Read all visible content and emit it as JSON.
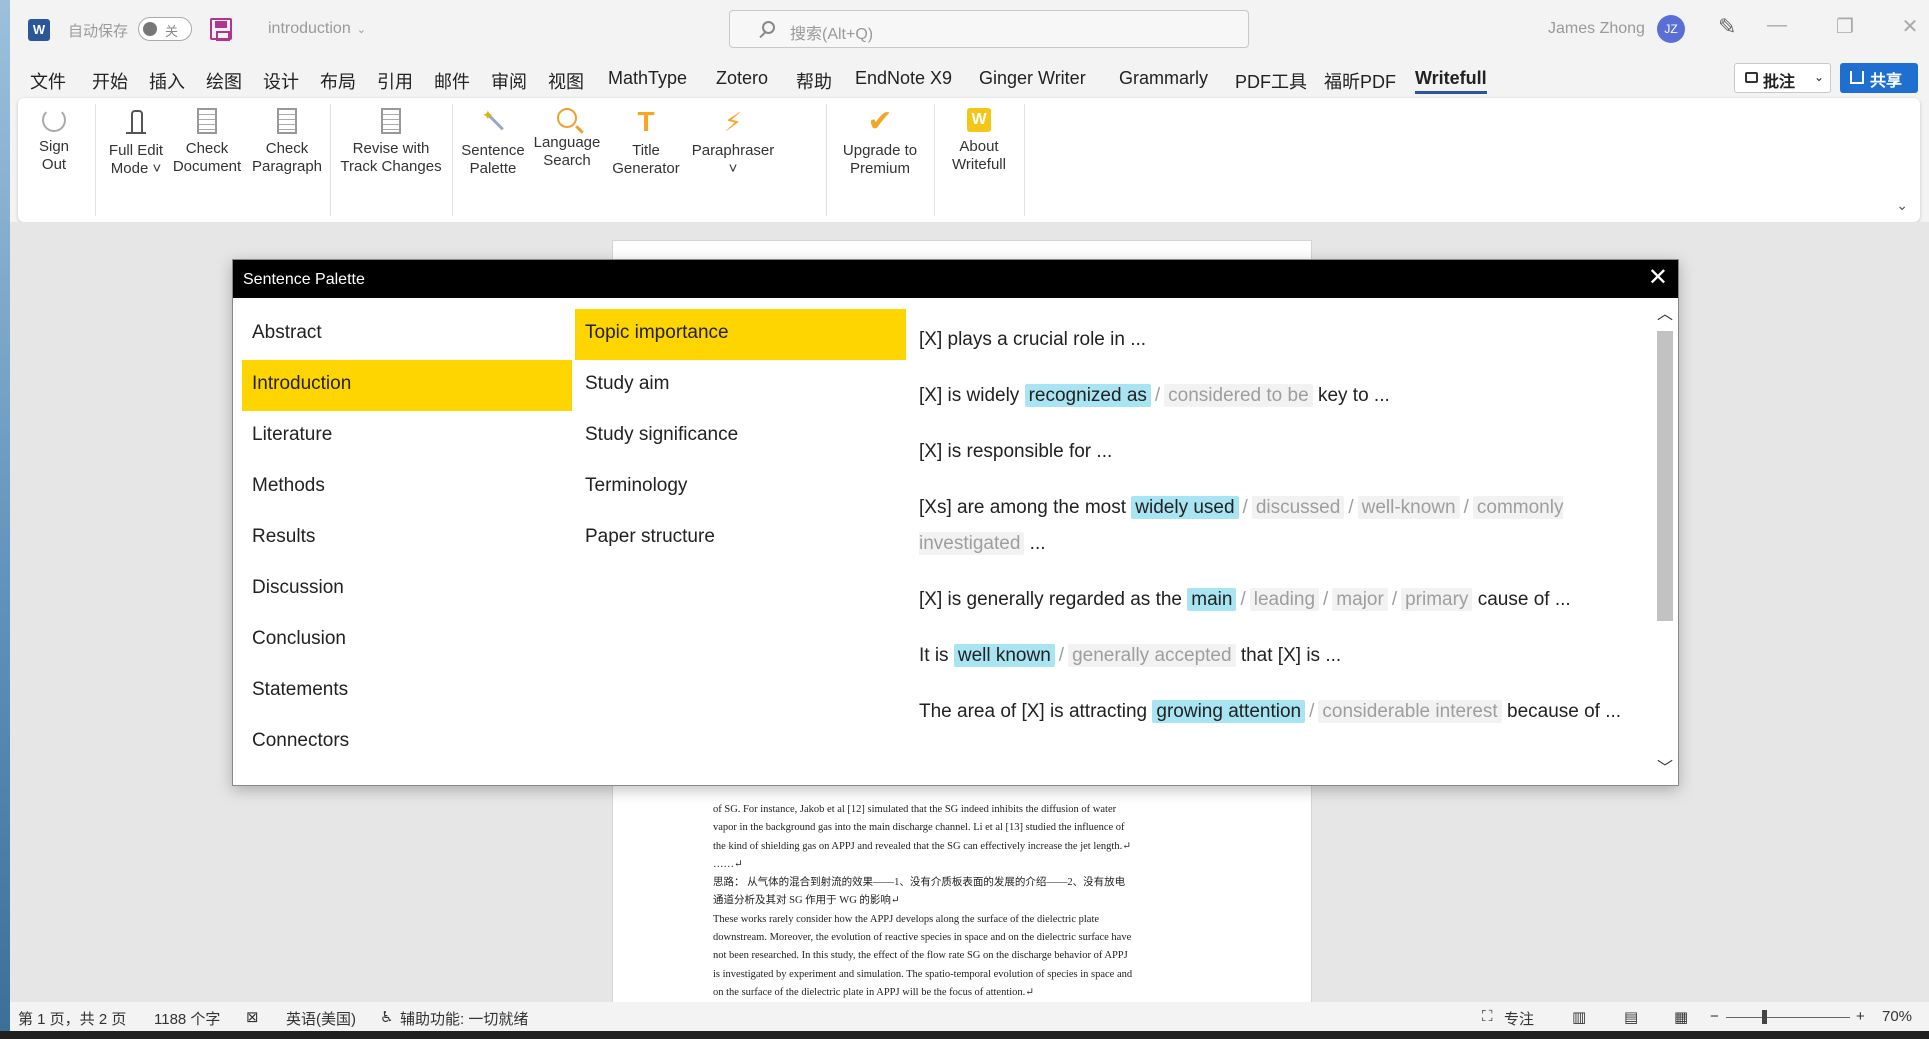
{
  "titlebar": {
    "app_icon": "W",
    "autosave_label": "自动保存",
    "autosave_state": "关",
    "document_name": "introduction",
    "search_placeholder": "搜索(Alt+Q)",
    "user_name": "James Zhong",
    "user_initials": "JZ",
    "icons": [
      "word-app-icon",
      "save-icon",
      "search-icon",
      "pen-icon",
      "minimize-icon",
      "restore-icon",
      "close-icon"
    ]
  },
  "menu": {
    "tabs": [
      "文件",
      "开始",
      "插入",
      "绘图",
      "设计",
      "布局",
      "引用",
      "邮件",
      "审阅",
      "视图",
      "MathType",
      "Zotero",
      "帮助",
      "EndNote X9",
      "Ginger Writer",
      "Grammarly",
      "PDF工具",
      "福昕PDF",
      "Writefull"
    ],
    "active_tab": "Writefull",
    "comments_label": "批注",
    "share_label": "共享"
  },
  "ribbon": {
    "buttons": [
      {
        "line1": "Sign",
        "line2": "Out"
      },
      {
        "line1": "Full Edit",
        "line2": "Mode ˅"
      },
      {
        "line1": "Check",
        "line2": "Document"
      },
      {
        "line1": "Check",
        "line2": "Paragraph"
      },
      {
        "line1": "Revise with",
        "line2": "Track Changes"
      },
      {
        "line1": "Sentence",
        "line2": "Palette"
      },
      {
        "line1": "Language",
        "line2": "Search"
      },
      {
        "line1": "Title",
        "line2": "Generator"
      },
      {
        "line1": "Paraphraser",
        "line2": "˅"
      },
      {
        "line1": "Upgrade to",
        "line2": "Premium"
      },
      {
        "line1": "About",
        "line2": "Writefull"
      }
    ],
    "expand_icon": "chevron-down-icon"
  },
  "document": {
    "lines": [
      "of SG. For instance, Jakob et al [12] simulated that the SG indeed inhibits the diffusion of water",
      "vapor in the background gas into the main discharge channel. Li et al [13] studied the influence of",
      "the kind of shielding gas on APPJ and revealed that the SG can effectively increase the jet length.↵",
      "……↵",
      "思路：  从气体的混合到射流的效果——1、没有介质板表面的发展的介绍——2、没有放电",
      "通道分析及其对 SG 作用于 WG 的影响↵",
      "These works rarely consider how the APPJ develops along the surface of the dielectric plate",
      "downstream. Moreover, the evolution of reactive species in space and on the dielectric surface have",
      "not been researched. In this study, the effect of the flow rate SG on the discharge behavior of APPJ",
      "is investigated by experiment and simulation. The spatio-temporal evolution of species in space and",
      "on the surface of the dielectric plate in APPJ will be the focus of attention.↵",
      "↵"
    ]
  },
  "statusbar": {
    "page_info": "第 1 页，共 2 页",
    "word_count": "1188 个字",
    "language": "英语(美国)",
    "accessibility": "辅助功能: 一切就绪",
    "focus_label": "专注",
    "zoom_level": "70%",
    "zoom_minus": "−",
    "zoom_plus": "+",
    "zoom_fraction": 0.29
  },
  "palette": {
    "title": "Sentence Palette",
    "close_label": "✕",
    "sections": [
      "Abstract",
      "Introduction",
      "Literature",
      "Methods",
      "Results",
      "Discussion",
      "Conclusion",
      "Statements",
      "Connectors"
    ],
    "selected_section": "Introduction",
    "topics": [
      "Topic importance",
      "Study aim",
      "Study significance",
      "Terminology",
      "Paper structure"
    ],
    "selected_topic": "Topic importance",
    "phrases": [
      {
        "parts": [
          {
            "t": "text",
            "v": "[X] plays a crucial role in ..."
          }
        ]
      },
      {
        "parts": [
          {
            "t": "text",
            "v": "[X] is widely "
          },
          {
            "t": "hl",
            "v": "recognized as"
          },
          {
            "t": "sep",
            "v": "/"
          },
          {
            "t": "alt",
            "v": "considered to be"
          },
          {
            "t": "text",
            "v": " key to ..."
          }
        ]
      },
      {
        "parts": [
          {
            "t": "text",
            "v": "[X] is responsible for ..."
          }
        ]
      },
      {
        "parts": [
          {
            "t": "text",
            "v": "[Xs] are among the most "
          },
          {
            "t": "hl",
            "v": "widely used"
          },
          {
            "t": "sep",
            "v": "/"
          },
          {
            "t": "alt",
            "v": "discussed"
          },
          {
            "t": "sep",
            "v": "/"
          },
          {
            "t": "alt",
            "v": "well-known"
          },
          {
            "t": "sep",
            "v": "/"
          },
          {
            "t": "alt",
            "v": "commonly investigated"
          },
          {
            "t": "text",
            "v": " ..."
          }
        ]
      },
      {
        "parts": [
          {
            "t": "text",
            "v": "[X] is generally regarded as the "
          },
          {
            "t": "hl",
            "v": "main"
          },
          {
            "t": "sep",
            "v": "/"
          },
          {
            "t": "alt",
            "v": "leading"
          },
          {
            "t": "sep",
            "v": "/"
          },
          {
            "t": "alt",
            "v": "major"
          },
          {
            "t": "sep",
            "v": "/"
          },
          {
            "t": "alt",
            "v": "primary"
          },
          {
            "t": "text",
            "v": " cause of ..."
          }
        ]
      },
      {
        "parts": [
          {
            "t": "text",
            "v": "It is "
          },
          {
            "t": "hl",
            "v": "well known"
          },
          {
            "t": "sep",
            "v": "/"
          },
          {
            "t": "alt",
            "v": "generally accepted"
          },
          {
            "t": "text",
            "v": " that [X] is ..."
          }
        ]
      },
      {
        "parts": [
          {
            "t": "text",
            "v": "The area of [X] is attracting "
          },
          {
            "t": "hl",
            "v": "growing attention"
          },
          {
            "t": "sep",
            "v": "/"
          },
          {
            "t": "alt",
            "v": "considerable interest"
          },
          {
            "t": "text",
            "v": " because of ..."
          }
        ]
      }
    ],
    "colors": {
      "selected": "#ffd500",
      "highlight": "#a8e4f2",
      "alternative_text": "#9e9e9e"
    }
  }
}
